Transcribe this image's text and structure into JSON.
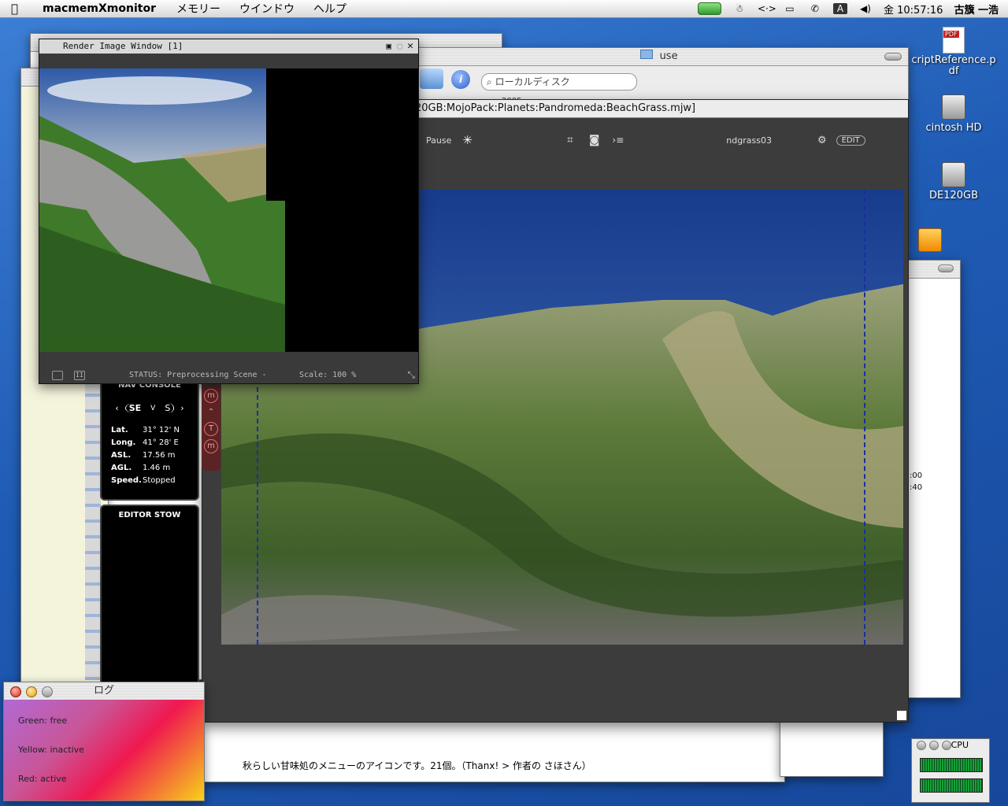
{
  "menubar": {
    "app_name": "macmemXmonitor",
    "menus": [
      "メモリー",
      "ウインドウ",
      "ヘルプ"
    ],
    "clock": "金 10:57:16",
    "user": "古籏 一浩",
    "icons": [
      "battery-icon",
      "spotlight-person-icon",
      "code-icon",
      "display-icon",
      "phone-icon",
      "font-a-icon",
      "volume-icon"
    ]
  },
  "desktop": {
    "icons": [
      {
        "name": "pdf-file-icon",
        "label": "criptReference.p\ndf"
      },
      {
        "name": "hard-disk-icon",
        "label": "cintosh HD"
      },
      {
        "name": "hard-disk-icon-2",
        "label": "DE120GB"
      },
      {
        "name": "firewire-disk-icon",
        "label": ""
      }
    ]
  },
  "finder": {
    "title": "use",
    "search_placeholder": "ローカルディスク",
    "partial_row": "2005"
  },
  "mojo": {
    "title": "20GB:MojoPack:Planets:Pandromeda:BeachGrass.mjw]",
    "pause_label": "Pause",
    "model_name": "ndgrass03",
    "edit_label": "EDIT"
  },
  "render": {
    "title": "Render Image Window [1]",
    "status": "STATUS:  Preprocessing Scene   -",
    "scale": "Scale:  100 %"
  },
  "nav_console": {
    "title": "NAV CONSOLE",
    "compass_left": "SE",
    "compass_mid": "V",
    "compass_right": "S",
    "rows": [
      {
        "k": "Lat.",
        "v": "31° 12' N"
      },
      {
        "k": "Long.",
        "v": "41° 28' E"
      },
      {
        "k": "ASL.",
        "v": "17.56 m"
      },
      {
        "k": "AGL.",
        "v": "1.46 m"
      },
      {
        "k": "Speed.",
        "v": "Stopped"
      }
    ],
    "tabs": [
      "m",
      "m",
      "T",
      "m"
    ]
  },
  "editor_stow": {
    "title": "EDITOR STOW"
  },
  "log": {
    "title": "ログ",
    "green": "Green:  free",
    "yellow": "Yellow:  inactive",
    "red": "Red:    active"
  },
  "cpu": {
    "title": "CPU"
  },
  "bottom_text": "秋らしい甘味処のメニューのアイコンです。21個。（Thanx! > 作者の さほさん）",
  "right_window_times": [
    ":00",
    ":40"
  ]
}
